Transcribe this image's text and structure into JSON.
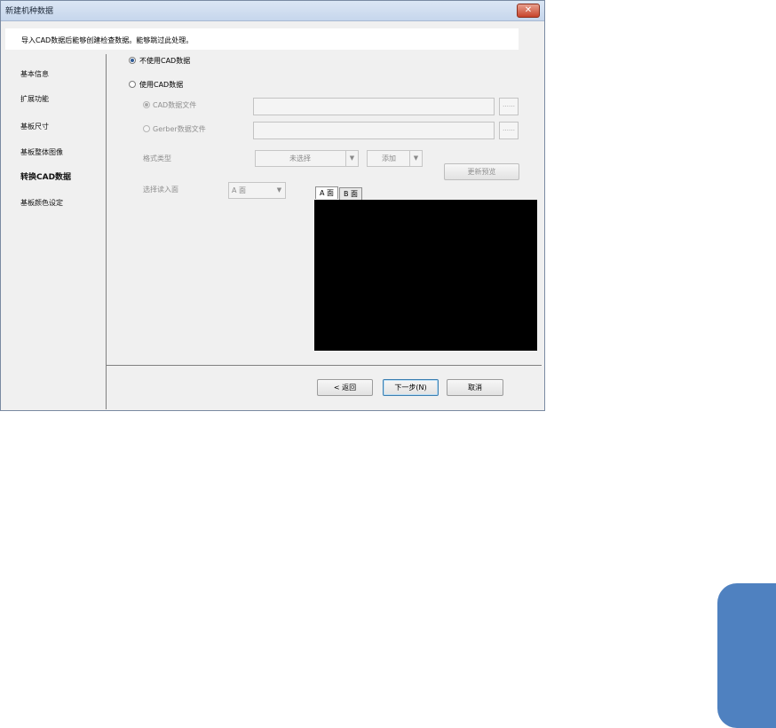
{
  "window": {
    "title": "新建机种数据",
    "close_label": "✕"
  },
  "banner": {
    "text": "导入CAD数据后能够创建检查数据。能够跳过此处理。"
  },
  "nav": {
    "items": [
      {
        "label": "基本信息"
      },
      {
        "label": "扩展功能"
      },
      {
        "label": "基板尺寸"
      },
      {
        "label": "基板整体图像"
      },
      {
        "label": "转换CAD数据",
        "active": true
      },
      {
        "label": "基板颜色设定"
      }
    ]
  },
  "options": {
    "no_cad_label": "不使用CAD数据",
    "use_cad_label": "使用CAD数据",
    "cad_file_label": "CAD数据文件",
    "gerber_file_label": "Gerber数据文件",
    "browse_label": "……"
  },
  "format": {
    "label": "格式类型",
    "selected": "未选择",
    "add_label": "添加",
    "update_preview_label": "更新预览"
  },
  "import_side": {
    "label": "选择读入面",
    "selected": "A 面"
  },
  "preview_tabs": [
    {
      "label": "A 面"
    },
    {
      "label": "B 面"
    }
  ],
  "footer": {
    "back_label": "<  返回",
    "next_label": "下一步(N)",
    "cancel_label": "取消"
  },
  "colors": {
    "side_tab": "#4f81c0",
    "preview_bg": "#000000"
  }
}
